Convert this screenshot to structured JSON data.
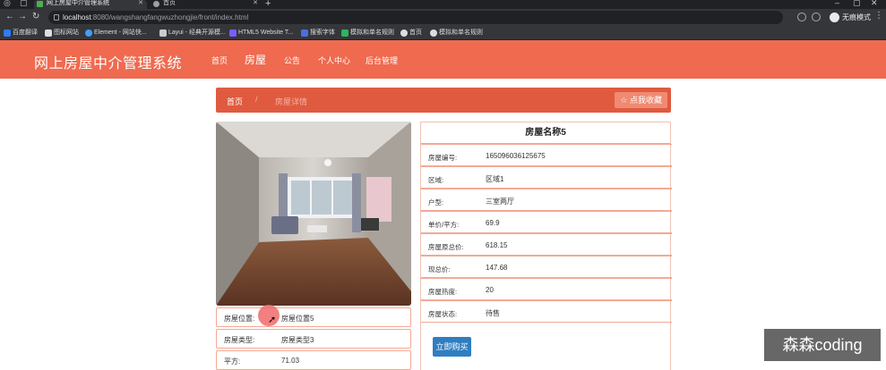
{
  "browser": {
    "tabs": [
      {
        "title": "网上房屋中介管理系统"
      },
      {
        "title": "首页"
      }
    ],
    "url_host": "localhost",
    "url_rest": ":8080/wangshangfangwuzhongjie/front/index.html",
    "incognito_label": "无痕模式",
    "bookmarks": [
      "百度翻译",
      "图标网站",
      "Element - 网站快...",
      "Layui - 经典开源模...",
      "HTML5 Website T...",
      "搜索字体",
      "模拟和单名规则",
      "首页",
      "模拟和单名规则"
    ]
  },
  "site": {
    "title": "网上房屋中介管理系统",
    "nav": [
      "首页",
      "房屋",
      "公告",
      "个人中心",
      "后台管理"
    ]
  },
  "breadcrumb": {
    "home": "首页",
    "separator": "/",
    "current": "房屋详情",
    "favorite_label": "☆ 点我收藏"
  },
  "left_info": [
    {
      "label": "房屋位置:",
      "value": "房屋位置5"
    },
    {
      "label": "房屋类型:",
      "value": "房屋类型3"
    },
    {
      "label": "平方:",
      "value": "71.03"
    }
  ],
  "detail": {
    "title": "房屋名称5",
    "rows": [
      {
        "label": "房屋编号:",
        "value": "165096036125675"
      },
      {
        "label": "区域:",
        "value": "区域1"
      },
      {
        "label": "户型:",
        "value": "三室两厅"
      },
      {
        "label": "单价/平方:",
        "value": "69.9"
      },
      {
        "label": "房屋原总价:",
        "value": "618.15"
      },
      {
        "label": "现总价:",
        "value": "147.68"
      },
      {
        "label": "房屋热度:",
        "value": "20"
      },
      {
        "label": "房屋状态:",
        "value": "待售"
      }
    ],
    "buy_label": "立即购买"
  },
  "watermark": "森森coding",
  "colors": {
    "header": "#ef6a4f",
    "breadcrumb": "#e05a3f",
    "buy": "#2f7ec1"
  }
}
